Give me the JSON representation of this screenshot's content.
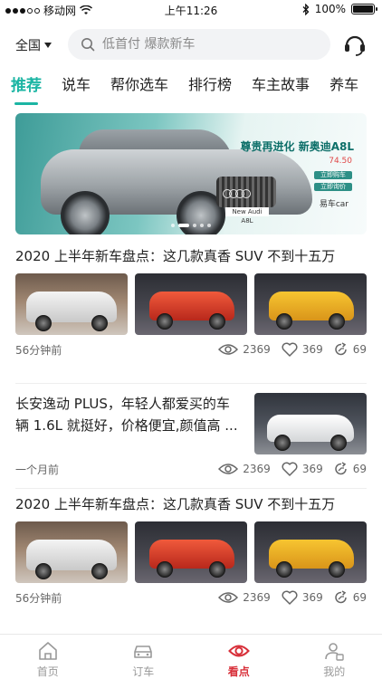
{
  "status_bar": {
    "carrier": "移动网",
    "time": "上午11:26",
    "battery_percent": "100%",
    "signal_bars_filled": 3,
    "signal_bars_total": 5
  },
  "header": {
    "city": "全国",
    "search_placeholder": "低首付 爆款新车"
  },
  "tabs": [
    {
      "label": "推荐",
      "active": true
    },
    {
      "label": "说车",
      "active": false
    },
    {
      "label": "帮你选车",
      "active": false
    },
    {
      "label": "排行榜",
      "active": false
    },
    {
      "label": "车主故事",
      "active": false
    },
    {
      "label": "养车",
      "active": false
    }
  ],
  "banner": {
    "headline": "尊贵再进化 新奥迪A8L",
    "price": "74.50",
    "plate": "New Audi A8L",
    "brand": "易车car",
    "button_1": "立即购车",
    "button_2": "立即询价"
  },
  "articles": [
    {
      "title": "2020 上半年新车盘点：这几款真香 SUV 不到十五万",
      "time": "56分钟前",
      "views": "2369",
      "likes": "369",
      "shares": "69"
    },
    {
      "title": "长安逸动 PLUS，年轻人都爱买的车辆 1.6L 就挺好，价格便宜,颜值高 ...",
      "time": "一个月前",
      "views": "2369",
      "likes": "369",
      "shares": "69"
    },
    {
      "title": "2020 上半年新车盘点：这几款真香 SUV 不到十五万",
      "time": "56分钟前",
      "views": "2369",
      "likes": "369",
      "shares": "69"
    }
  ],
  "bottom_nav": [
    {
      "label": "首页",
      "icon": "home-icon",
      "active": false
    },
    {
      "label": "订车",
      "icon": "car-icon",
      "active": false
    },
    {
      "label": "看点",
      "icon": "eye-icon",
      "active": true
    },
    {
      "label": "我的",
      "icon": "user-icon",
      "active": false
    }
  ],
  "colors": {
    "accent_teal": "#1bb5a3",
    "active_nav_red": "#d8303a"
  }
}
